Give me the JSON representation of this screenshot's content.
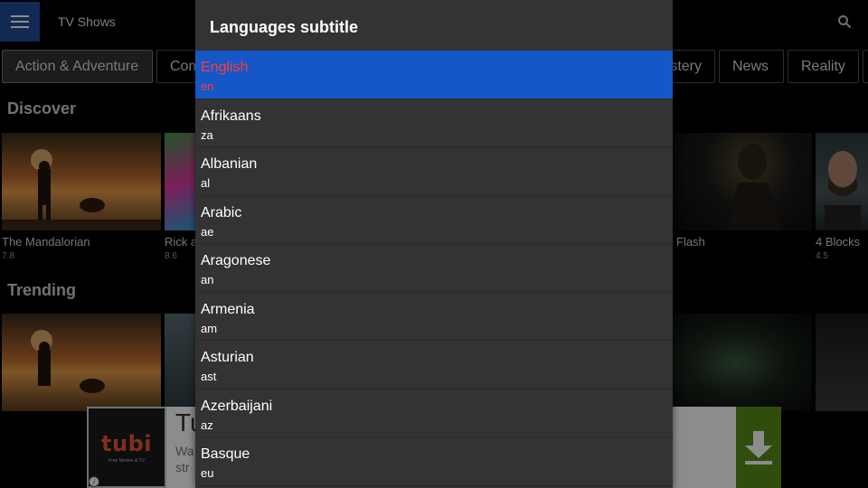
{
  "header": {
    "title": "TV Shows"
  },
  "genres": [
    {
      "label": "Action & Adventure",
      "active": true
    },
    {
      "label": "Com"
    },
    {
      "label": "ystery"
    },
    {
      "label": "News"
    },
    {
      "label": "Reality"
    }
  ],
  "sections": {
    "discover": "Discover",
    "trending": "Trending"
  },
  "discover_shows": [
    {
      "title": "The Mandalorian",
      "rating": "7.8"
    },
    {
      "title": "Rick a",
      "rating": "8.6"
    },
    {
      "title": "Flash",
      "rating": ""
    },
    {
      "title": "4 Blocks",
      "rating": "4.5"
    }
  ],
  "ad": {
    "logo_word": "tubi",
    "logo_tagline": "Free Movies & TV",
    "headline": "Tu",
    "body_line1": "Wa",
    "body_line2": "str",
    "info_icon": "i",
    "accent_color": "#5a8c1a"
  },
  "dialog": {
    "title": "Languages subtitle",
    "selected_color": "#1657c8",
    "selected_text_color": "#ff3b3b",
    "languages": [
      {
        "name": "English",
        "code": "en",
        "selected": true
      },
      {
        "name": "Afrikaans",
        "code": "za"
      },
      {
        "name": "Albanian",
        "code": "al"
      },
      {
        "name": "Arabic",
        "code": "ae"
      },
      {
        "name": "Aragonese",
        "code": "an"
      },
      {
        "name": "Armenia",
        "code": "am"
      },
      {
        "name": "Asturian",
        "code": "ast"
      },
      {
        "name": "Azerbaijani",
        "code": "az"
      },
      {
        "name": "Basque",
        "code": "eu"
      }
    ]
  }
}
